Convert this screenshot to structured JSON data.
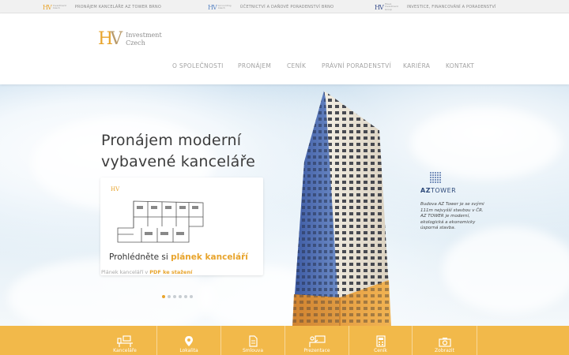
{
  "topstrip": {
    "links": [
      {
        "mini_line1": "Investment",
        "mini_line2": "Czech",
        "label": "PRONÁJEM KANCELÁŘE AZ TOWER BRNO"
      },
      {
        "mini_line1": "Accounting",
        "mini_line2": "Czech",
        "label": "ÚČETNICTVÍ A DAŇOVÉ PORADENSTVÍ BRNO"
      },
      {
        "mini_line1": "Hlava",
        "mini_line2": "Investment Group",
        "label": "INVESTICE, FINANCOVÁNÍ A PORADENSTVÍ"
      }
    ]
  },
  "logo": {
    "mark_h": "H",
    "mark_v": "V",
    "line1": "Investment",
    "line2": "Czech"
  },
  "nav": {
    "items": [
      "O SPOLEČNOSTI",
      "PRONÁJEM",
      "CENÍK",
      "PRÁVNÍ PORADENSTVÍ",
      "KARIÉRA",
      "KONTAKT"
    ]
  },
  "hero": {
    "title_line1": "Pronájem moderní",
    "title_line2": "vybavené kanceláře",
    "card_mini_logo": "HV",
    "cta_prefix": "Prohlédněte si ",
    "cta_accent": "plánek kanceláří",
    "pdf_prefix": "Plánek kanceláří v ",
    "pdf_accent": "PDF ke stažení",
    "slides_total": 6,
    "slide_active": 1
  },
  "aztower": {
    "name_a": "AZ",
    "name_b": "TOWER",
    "description": "Budova AZ Tower je se svými 111m nejvyšší stavbou v ČR. AZ TOWER je moderní, ekologická a ekonomicky úsporná stavba."
  },
  "bottombar": {
    "tiles": [
      {
        "icon": "office-desk-icon",
        "label": "Kanceláře"
      },
      {
        "icon": "map-pin-icon",
        "label": "Lokalita"
      },
      {
        "icon": "document-icon",
        "label": "Smlouva"
      },
      {
        "icon": "presentation-icon",
        "label": "Prezentace"
      },
      {
        "icon": "calculator-icon",
        "label": "Ceník"
      },
      {
        "icon": "camera-icon",
        "label": "Zobrazit"
      }
    ]
  },
  "colors": {
    "accent": "#e8a42c",
    "bar": "#f2b94a",
    "az_blue": "#2e4a7a"
  }
}
